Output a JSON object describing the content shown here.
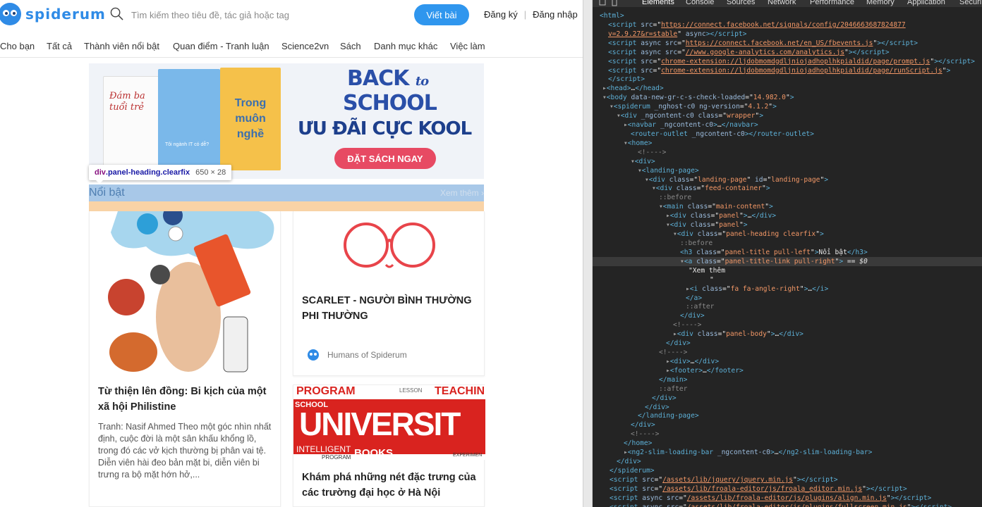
{
  "navbar": {
    "logo_text": "spiderum",
    "search_placeholder": "Tìm kiếm theo tiêu đề, tác giả hoặc tag",
    "write_button": "Viết bài",
    "register": "Đăng ký",
    "divider": "|",
    "login": "Đăng nhập"
  },
  "categories": [
    "Cho bạn",
    "Tất cả",
    "Thành viên nổi bật",
    "Quan điểm - Tranh luận",
    "Science2vn",
    "Sách",
    "Danh mục khác",
    "Việc làm"
  ],
  "banner": {
    "title_back": "BACK",
    "title_to": "to",
    "title_school": "SCHOOL",
    "subtitle": "ƯU ĐÃI CỰC KOOL",
    "cta": "ĐẶT SÁCH NGAY",
    "book_texts": [
      "Đám ba tuổi trẻ",
      "Tôi ngành IT có dễ?",
      "Trong muôn nghề"
    ]
  },
  "inspector_tooltip": {
    "tag": "div",
    "classes": ".panel-heading.clearfix",
    "size": "650 × 28"
  },
  "panel": {
    "title": "Nổi bật",
    "more": "Xem thêm ›"
  },
  "cards": [
    {
      "title": "Từ thiện lên đồng: Bi kịch của một xã hội Philistine",
      "desc": "Tranh: Nasif Ahmed Theo một góc nhìn nhất định, cuộc đời là một sân khấu khổng lồ, trong đó các vở kịch thường bị phân vai tệ. Diễn viên hài đeo bản mặt bi, diễn viên bi trưng ra bộ mặt hớn hở,..."
    },
    {
      "title": "SCARLET - NGƯỜI BÌNH THƯỜNG PHI THƯỜNG",
      "author": "Humans of Spiderum"
    },
    {
      "title": "Khám phá những nét đặc trưng của các trường đại học ở Hà Nội",
      "image_words": [
        "PROGRAM",
        "LESSON",
        "TEACHIN",
        "SCHOOL",
        "UNIVERSIT",
        "INTELLIGENT",
        "BOOKS",
        "PROGRAM",
        "EXPERIMEN"
      ]
    }
  ],
  "devtools": {
    "tabs": [
      "Elements",
      "Console",
      "Sources",
      "Network",
      "Performance",
      "Memory",
      "Application",
      "Securi"
    ],
    "active_tab": "Elements",
    "lines": [
      {
        "html": "<span class='t'>&lt;html&gt;</span>"
      },
      {
        "html": "<span class='t'>&lt;script</span> <span class='a'>src</span>=\"<span class='u'>https://connect.facebook.net/signals/config/2046663687824877</span>"
      },
      {
        "html": "<span class='u'>v=2.9.27&amp;r=stable</span>\" <span class='a'>async</span><span class='t'>&gt;&lt;/script&gt;</span>"
      },
      {
        "html": "<span class='t'>&lt;script</span> <span class='a'>async src</span>=\"<span class='u'>https://connect.facebook.net/en_US/fbevents.js</span>\"<span class='t'>&gt;&lt;/script&gt;</span>"
      },
      {
        "html": "<span class='t'>&lt;script</span> <span class='a'>async src</span>=\"<span class='u'>//www.google-analytics.com/analytics.js</span>\"<span class='t'>&gt;&lt;/script&gt;</span>"
      },
      {
        "html": "<span class='t'>&lt;script</span> <span class='a'>src</span>=\"<span class='u'>chrome-extension://ljdobmomdgdljniojadhoplhkpialdid/page/prompt.js</span>\"<span class='t'>&gt;&lt;/script&gt;</span>"
      },
      {
        "html": "<span class='t'>&lt;script</span> <span class='a'>src</span>=\"<span class='u'>chrome-extension://ljdobmomdgdljniojadhoplhkpialdid/page/runScript.js</span>\"<span class='t'>&gt;</span>"
      },
      {
        "html": "<span class='t'>&lt;/script&gt;</span>"
      },
      {
        "html": "<span class='tri'>▸</span><span class='t'>&lt;head&gt;</span>…<span class='t'>&lt;/head&gt;</span>"
      },
      {
        "html": "<span class='tri'>▾</span><span class='t'>&lt;body</span> <span class='a'>data-new-gr-c-s-check-loaded</span>=\"<span class='v'>14.982.0</span>\"<span class='t'>&gt;</span>"
      },
      {
        "html": "<span class='tri'>▾</span><span class='t'>&lt;spiderum</span> <span class='a'>_nghost-c0 ng-version</span>=\"<span class='v'>4.1.2</span>\"<span class='t'>&gt;</span>"
      },
      {
        "html": "<span class='tri'>▾</span><span class='t'>&lt;div</span> <span class='a'>_ngcontent-c0 class</span>=\"<span class='v'>wrapper</span>\"<span class='t'>&gt;</span>"
      },
      {
        "html": "<span class='tri'>▸</span><span class='t'>&lt;navbar</span> <span class='a'>_ngcontent-c0</span><span class='t'>&gt;</span>…<span class='t'>&lt;/navbar&gt;</span>"
      },
      {
        "html": "<span class='t'>&lt;router-outlet</span> <span class='a'>_ngcontent-c0</span><span class='t'>&gt;&lt;/router-outlet&gt;</span>"
      },
      {
        "html": "<span class='tri'>▾</span><span class='t'>&lt;home&gt;</span>"
      },
      {
        "html": "<span class='c'>&lt;!----&gt;</span>"
      },
      {
        "html": "<span class='tri'>▾</span><span class='t'>&lt;div&gt;</span>"
      },
      {
        "html": "<span class='tri'>▾</span><span class='t'>&lt;landing-page&gt;</span>"
      },
      {
        "html": "<span class='tri'>▾</span><span class='t'>&lt;div</span> <span class='a'>class</span>=\"<span class='v'>landing-page</span>\" <span class='a'>id</span>=\"<span class='v'>landing-page</span>\"<span class='t'>&gt;</span>"
      },
      {
        "html": "<span class='tri'>▾</span><span class='t'>&lt;div</span> <span class='a'>class</span>=\"<span class='v'>feed-container</span>\"<span class='t'>&gt;</span>"
      },
      {
        "html": "<span class='c'>::before</span>"
      },
      {
        "html": "<span class='tri'>▾</span><span class='t'>&lt;main</span> <span class='a'>class</span>=\"<span class='v'>main-content</span>\"<span class='t'>&gt;</span>"
      },
      {
        "html": "<span class='tri'>▸</span><span class='t'>&lt;div</span> <span class='a'>class</span>=\"<span class='v'>panel</span>\"<span class='t'>&gt;</span>…<span class='t'>&lt;/div&gt;</span>"
      },
      {
        "html": "<span class='tri'>▾</span><span class='t'>&lt;div</span> <span class='a'>class</span>=\"<span class='v'>panel</span>\"<span class='t'>&gt;</span>"
      },
      {
        "html": "<span class='tri'>▾</span><span class='t'>&lt;div</span> <span class='a'>class</span>=\"<span class='v'>panel-heading clearfix</span>\"<span class='t'>&gt;</span>"
      },
      {
        "html": "<span class='c'>::before</span>"
      },
      {
        "html": "<span class='t'>&lt;h3</span> <span class='a'>class</span>=\"<span class='v'>panel-title pull-left</span>\"<span class='t'>&gt;</span><span class='w'>Nổi bật</span><span class='t'>&lt;/h3&gt;</span>"
      },
      {
        "html": "<span class='tri'>▾</span><span class='t'>&lt;a</span> <span class='a'>class</span>=\"<span class='v'>panel-title-link pull-right</span>\"<span class='t'>&gt;</span> <span class='w'>== <i>$0</i></span>"
      },
      {
        "html": "<span class='w'>\"Xem thêm</span>"
      },
      {
        "html": "<span class='w'>\"</span>"
      },
      {
        "html": "<span class='tri'>▸</span><span class='t'>&lt;i</span> <span class='a'>class</span>=\"<span class='v'>fa fa-angle-right</span>\"<span class='t'>&gt;</span>…<span class='t'>&lt;/i&gt;</span>"
      },
      {
        "html": "<span class='t'>&lt;/a&gt;</span>"
      },
      {
        "html": "<span class='c'>::after</span>"
      },
      {
        "html": "<span class='t'>&lt;/div&gt;</span>"
      },
      {
        "html": "<span class='c'>&lt;!----&gt;</span>"
      },
      {
        "html": "<span class='tri'>▸</span><span class='t'>&lt;div</span> <span class='a'>class</span>=\"<span class='v'>panel-body</span>\"<span class='t'>&gt;</span>…<span class='t'>&lt;/div&gt;</span>"
      },
      {
        "html": "<span class='t'>&lt;/div&gt;</span>"
      },
      {
        "html": "<span class='c'>&lt;!----&gt;</span>"
      },
      {
        "html": "<span class='tri'>▸</span><span class='t'>&lt;div&gt;</span>…<span class='t'>&lt;/div&gt;</span>"
      },
      {
        "html": "<span class='tri'>▸</span><span class='t'>&lt;footer&gt;</span>…<span class='t'>&lt;/footer&gt;</span>"
      },
      {
        "html": "<span class='t'>&lt;/main&gt;</span>"
      },
      {
        "html": "<span class='c'>::after</span>"
      },
      {
        "html": "<span class='t'>&lt;/div&gt;</span>"
      },
      {
        "html": "<span class='t'>&lt;/div&gt;</span>"
      },
      {
        "html": "<span class='t'>&lt;/landing-page&gt;</span>"
      },
      {
        "html": "<span class='t'>&lt;/div&gt;</span>"
      },
      {
        "html": "<span class='c'>&lt;!----&gt;</span>"
      },
      {
        "html": "<span class='t'>&lt;/home&gt;</span>"
      },
      {
        "html": "<span class='tri'>▸</span><span class='t'>&lt;ng2-slim-loading-bar</span> <span class='a'>_ngcontent-c0</span><span class='t'>&gt;</span>…<span class='t'>&lt;/ng2-slim-loading-bar&gt;</span>"
      },
      {
        "html": "<span class='t'>&lt;/div&gt;</span>"
      },
      {
        "html": "<span class='t'>&lt;/spiderum&gt;</span>"
      },
      {
        "html": "<span class='t'>&lt;script</span> <span class='a'>src</span>=\"<span class='u'>/assets/lib/jquery/jquery.min.js</span>\"<span class='t'>&gt;&lt;/script&gt;</span>"
      },
      {
        "html": "<span class='t'>&lt;script</span> <span class='a'>src</span>=\"<span class='u'>/assets/lib/froala-editor/js/froala_editor.min.js</span>\"<span class='t'>&gt;&lt;/script&gt;</span>"
      },
      {
        "html": "<span class='t'>&lt;script</span> <span class='a'>async src</span>=\"<span class='u'>/assets/lib/froala-editor/js/plugins/align.min.js</span>\"<span class='t'>&gt;&lt;/script&gt;</span>"
      },
      {
        "html": "<span class='t'>&lt;script</span> <span class='a'>async src</span>=\"<span class='u'>/assets/lib/froala-editor/js/plugins/fullscreen.min.js</span>\"<span class='t'>&gt;&lt;/script&gt;</span>"
      }
    ]
  }
}
